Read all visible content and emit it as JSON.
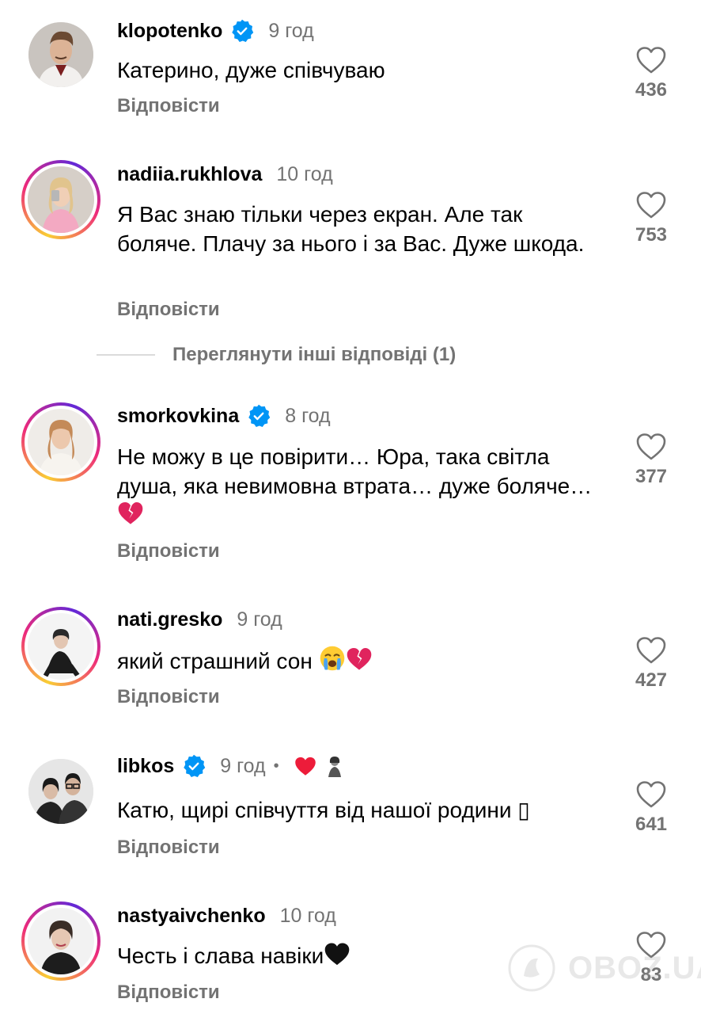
{
  "comments": [
    {
      "username": "klopotenko",
      "verified": true,
      "time": "9 год",
      "text": "Катерино, дуже співчуваю",
      "reply": "Відповісти",
      "likes": "436"
    },
    {
      "username": "nadiia.rukhlova",
      "verified": false,
      "time": "10 год",
      "text": "Я Вас знаю тільки через екран. Але так боляче. Плачу за нього і за Вас. Дуже шкода.",
      "reply": "Відповісти",
      "likes": "753"
    },
    {
      "username": "smorkovkina",
      "verified": true,
      "time": "8 год",
      "text": "Не можу в це повірити… Юра, така світла душа, яка невимовна втрата… дуже боляче…",
      "reply": "Відповісти",
      "likes": "377"
    },
    {
      "username": "nati.gresko",
      "verified": false,
      "time": "9 год",
      "text": "який страшний сон",
      "reply": "Відповісти",
      "likes": "427"
    },
    {
      "username": "libkos",
      "verified": true,
      "time": "9 год",
      "separator": "•",
      "text": "Катю, щирі співчуття від нашої родини ▯",
      "reply": "Відповісти",
      "likes": "641"
    },
    {
      "username": "nastyaivchenko",
      "verified": false,
      "time": "10 год",
      "text": "Честь і слава навіки",
      "reply": "Відповісти",
      "likes": "83"
    }
  ],
  "view_more_replies": "Переглянути інші відповіді (1)",
  "watermark": "OBOZ.UA",
  "colors": {
    "verified": "#0095f6",
    "secondary_text": "#737373",
    "heart_red": "#ed1c3a"
  }
}
